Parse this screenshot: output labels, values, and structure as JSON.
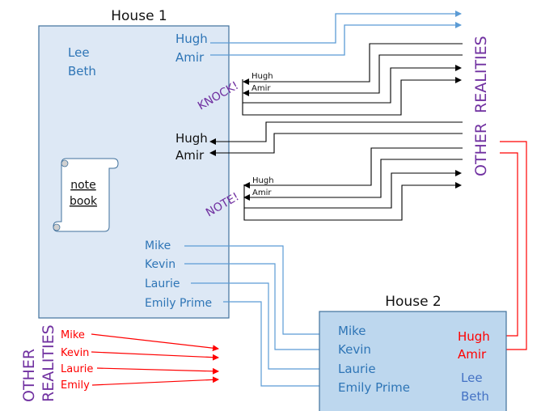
{
  "house1": {
    "title": "House 1",
    "residents": [
      "Lee",
      "Beth"
    ],
    "travelers_out": [
      "Hugh",
      "Amir"
    ],
    "travelers_returned": [
      "Hugh",
      "Amir"
    ],
    "notebook": {
      "line1": "note",
      "line2": "book"
    },
    "sent_to_house2": [
      "Mike",
      "Kevin",
      "Laurie",
      "Emily Prime"
    ]
  },
  "knock_group": {
    "label": "KNOCK!",
    "names": [
      "Hugh",
      "Amir"
    ]
  },
  "note_group": {
    "label": "NOTE!",
    "names": [
      "Hugh",
      "Amir"
    ]
  },
  "other_realities_right": {
    "word1": "OTHER",
    "word2": "REALITIES"
  },
  "other_realities_left": {
    "word1": "OTHER",
    "word2": "REALITIES",
    "names": [
      "Mike",
      "Kevin",
      "Laurie",
      "Emily"
    ]
  },
  "house2": {
    "title": "House 2",
    "arrivals": [
      "Mike",
      "Kevin",
      "Laurie",
      "Emily Prime"
    ],
    "visitors": [
      "Hugh",
      "Amir"
    ],
    "residents": [
      "Lee",
      "Beth"
    ]
  },
  "colors": {
    "house1_fill": "#dde8f5",
    "house2_fill": "#bdd7ee",
    "box_border": "#41719c",
    "blue_text": "#2e75b6",
    "blue_line": "#5b9bd5",
    "red": "#ff0000",
    "purple": "#7030a0"
  }
}
